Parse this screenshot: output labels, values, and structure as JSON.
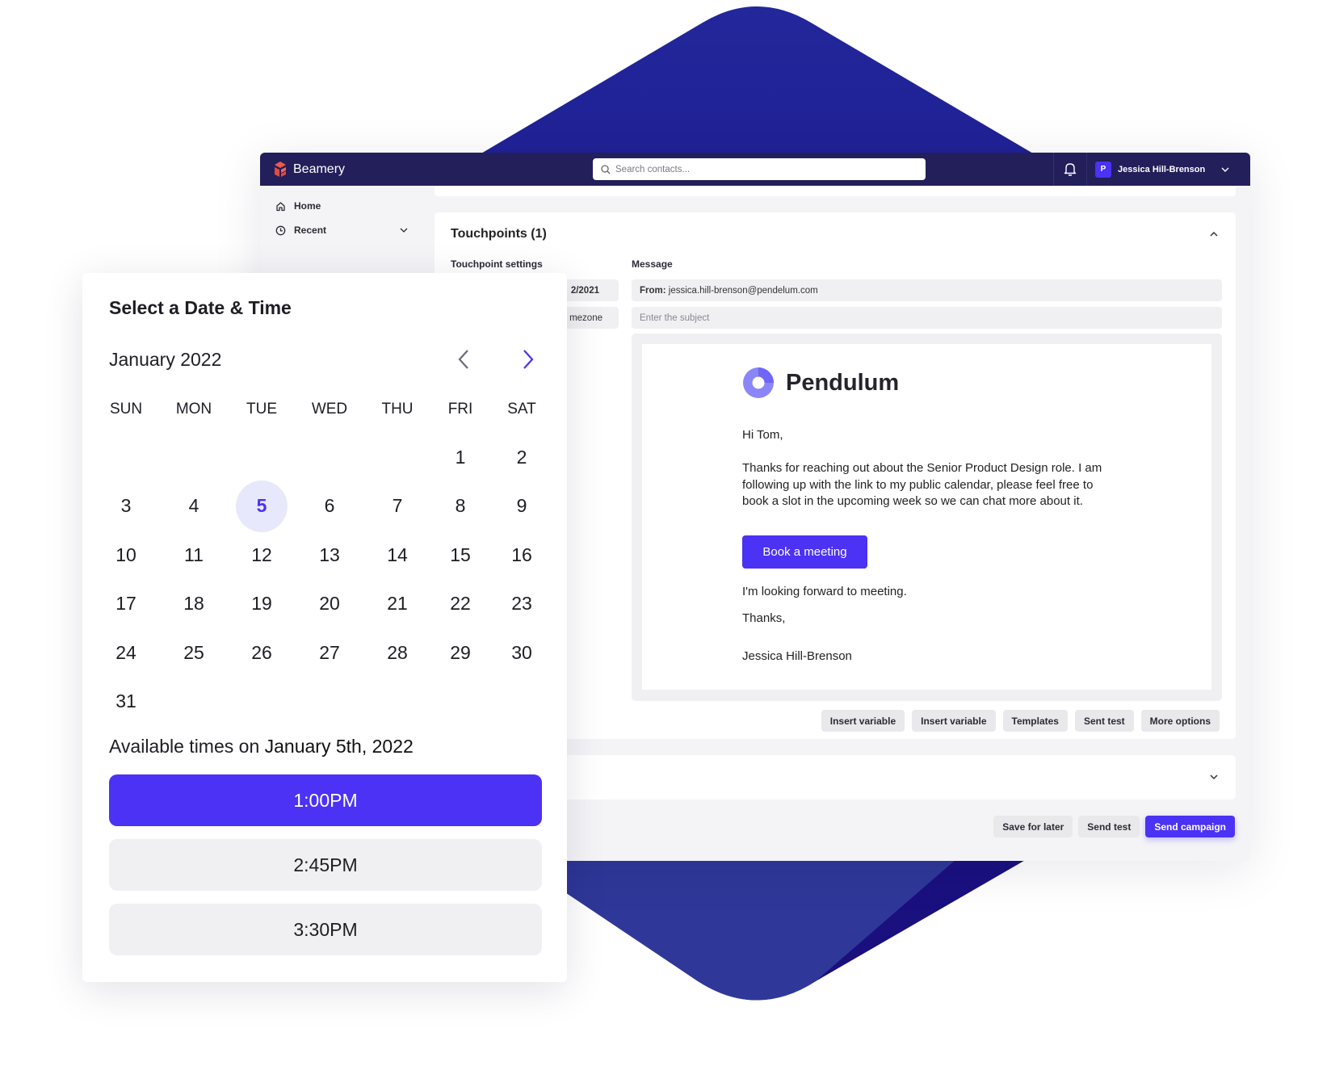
{
  "app": {
    "brand": "Beamery",
    "accent": "#4b32f5",
    "header_bg": "#221f5a"
  },
  "header": {
    "search_placeholder": "Search contacts...",
    "user_initial": "P",
    "user_name": "Jessica Hill-Brenson"
  },
  "sidebar": {
    "items": [
      {
        "label": "Home",
        "icon": "home-icon"
      },
      {
        "label": "Recent",
        "icon": "clock-icon",
        "expandable": true
      }
    ]
  },
  "touchpoints": {
    "title": "Touchpoints (1)",
    "settings_label": "Touchpoint settings",
    "message_label": "Message",
    "settings_fields": [
      "2/2021",
      "mezone"
    ],
    "from_label": "From:",
    "from_value": "jessica.hill-brenson@pendelum.com",
    "subject_placeholder": "Enter the subject",
    "email": {
      "brand": "Pendulum",
      "greeting": "Hi Tom,",
      "body": "Thanks for reaching out about the Senior Product Design role. I am following up with the link to my public calendar, please feel free to book a slot in the upcoming week so we can chat more about it.",
      "cta": "Book a meeting",
      "closing_line": "I'm looking forward to meeting.",
      "signoff": "Thanks,",
      "signature": "Jessica Hill-Brenson"
    },
    "toolbar_buttons": [
      "Insert variable",
      "Insert variable",
      "Templates",
      "Sent test",
      "More options"
    ]
  },
  "footer_buttons": {
    "save": "Save for later",
    "test": "Send test",
    "send": "Send campaign"
  },
  "calendar": {
    "title": "Select a Date & Time",
    "month": "January 2022",
    "weekdays": [
      "SUN",
      "MON",
      "TUE",
      "WED",
      "THU",
      "FRI",
      "SAT"
    ],
    "first_weekday_index": 5,
    "days_in_month": 31,
    "selected_day": 5,
    "available_prefix": "Available times on",
    "available_date": "January 5th, 2022",
    "times": [
      {
        "label": "1:00PM",
        "selected": true
      },
      {
        "label": "2:45PM",
        "selected": false
      },
      {
        "label": "3:30PM",
        "selected": false
      }
    ]
  }
}
